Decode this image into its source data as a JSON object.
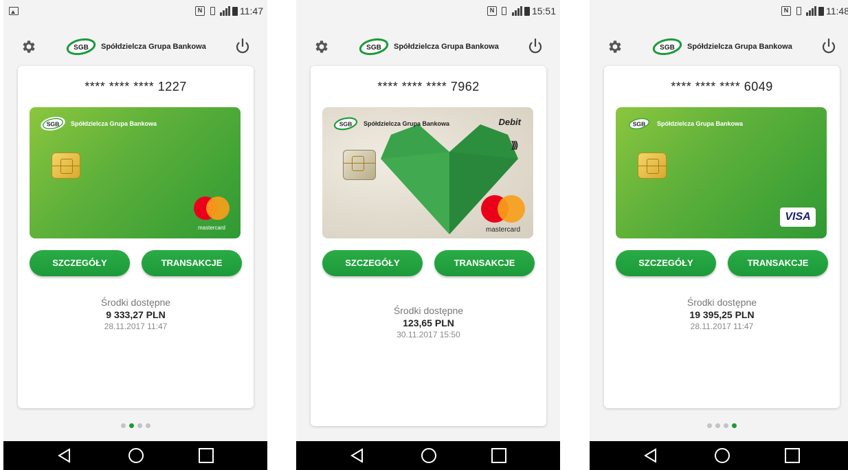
{
  "phones": [
    {
      "status": {
        "time": "11:47",
        "nfc": "N"
      },
      "bank_name": "Spółdzielcza Grupa Bankowa",
      "logo_abbr": "SGB",
      "card": {
        "masked_number": "**** **** **** 1227",
        "network": "mastercard",
        "design": "green"
      },
      "buttons": {
        "details": "SZCZEGÓŁY",
        "transactions": "TRANSAKCJE"
      },
      "balance": {
        "label": "Środki dostępne",
        "amount": "9 333,27 PLN",
        "date": "28.11.2017 11:47"
      },
      "pager": {
        "count": 4,
        "active": 2
      }
    },
    {
      "status": {
        "time": "15:51",
        "nfc": "N"
      },
      "bank_name": "Spółdzielcza Grupa Bankowa",
      "logo_abbr": "SGB",
      "card": {
        "masked_number": "**** **** **** 7962",
        "network": "mastercard",
        "design": "heart",
        "type_label": "Debit",
        "contactless": ")))"
      },
      "buttons": {
        "details": "SZCZEGÓŁY",
        "transactions": "TRANSAKCJE"
      },
      "balance": {
        "label": "Środki dostępne",
        "amount": "123,65 PLN",
        "date": "30.11.2017 15:50"
      }
    },
    {
      "status": {
        "time": "11:48",
        "nfc": "N"
      },
      "bank_name": "Spółdzielcza Grupa Bankowa",
      "logo_abbr": "SGB",
      "card": {
        "masked_number": "**** **** **** 6049",
        "network": "VISA",
        "design": "green"
      },
      "buttons": {
        "details": "SZCZEGÓŁY",
        "transactions": "TRANSAKCJE"
      },
      "balance": {
        "label": "Środki dostępne",
        "amount": "19 395,25 PLN",
        "date": "28.11.2017 11:47"
      },
      "pager": {
        "count": 4,
        "active": 4
      }
    }
  ],
  "colors": {
    "primary_green": "#1c9a3a",
    "card_green": "#5fb13a",
    "background": "#f3f3f3"
  },
  "icons": [
    "settings-gear-icon",
    "power-icon",
    "back-icon",
    "home-icon",
    "recent-apps-icon",
    "nfc-icon",
    "vibrate-icon",
    "signal-icon",
    "battery-icon",
    "image-notification-icon"
  ]
}
